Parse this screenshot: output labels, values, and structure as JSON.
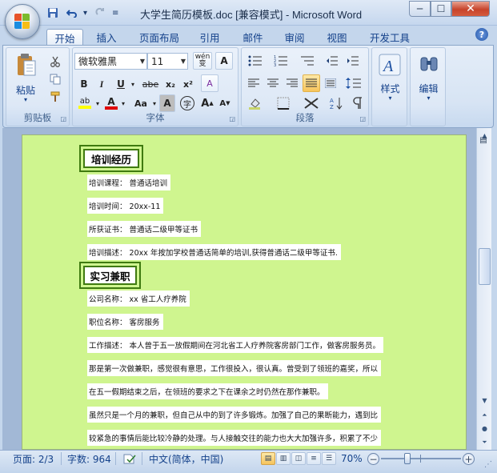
{
  "window": {
    "title": "大学生简历模板.doc [兼容模式] - Microsoft Word",
    "minimize": "─",
    "maximize": "☐",
    "close": "✕"
  },
  "quick_access": {
    "save_icon": "save-icon",
    "undo_icon": "undo-icon",
    "redo_icon": "redo-icon",
    "customize_icon": "customize-qat-icon"
  },
  "tabs": [
    {
      "label": "开始",
      "active": true
    },
    {
      "label": "插入",
      "active": false
    },
    {
      "label": "页面布局",
      "active": false
    },
    {
      "label": "引用",
      "active": false
    },
    {
      "label": "邮件",
      "active": false
    },
    {
      "label": "审阅",
      "active": false
    },
    {
      "label": "视图",
      "active": false
    },
    {
      "label": "开发工具",
      "active": false
    }
  ],
  "ribbon": {
    "clipboard": {
      "group_label": "剪贴板",
      "paste_label": "粘贴"
    },
    "font": {
      "group_label": "字体",
      "font_name": "微软雅黑",
      "font_size": "11",
      "wen_label": "wén",
      "wen_char": "变",
      "a_box": "A",
      "bold": "B",
      "italic": "I",
      "underline": "U",
      "strike": "abe",
      "subscript": "x₂",
      "superscript": "x²",
      "clear_format": "A",
      "highlight": "ab",
      "font_color": "A",
      "change_case": "Aa",
      "char_shade": "A",
      "enclose": "字",
      "grow": "A",
      "shrink": "A"
    },
    "paragraph": {
      "group_label": "段落"
    },
    "styles": {
      "label": "样式",
      "icon": "styles-icon"
    },
    "editing": {
      "label": "编辑",
      "icon": "find-binoculars-icon"
    }
  },
  "document": {
    "sections": [
      {
        "heading": "培训经历"
      },
      {
        "heading": "实习兼职"
      }
    ],
    "lines": [
      "培训课程：   普通话培训",
      "培训时间：   20xx-11",
      "所获证书：   普通话二级甲等证书",
      "培训描述：   20xx 年按加学校普通话简单的培训,获得普通话二级甲等证书.",
      "公司名称：   xx 省工人疗养院",
      "职位名称：   客房服务",
      "工作描述：  本人曾于五一放假期间在河北省工人疗养院客房部门工作，做客房服务员。",
      "那是第一次做兼职，感觉很有意思，工作很投入，很认真。曾受到了领班的嘉奖，所以",
      "在五一假期结束之后，在领班的要求之下在课余之时仍然在那作兼职。",
      "虽然只是一个月的兼职，但自己从中的到了许多锻炼。加强了自己的果断能力，遇到比",
      "较紧急的事情后能比较冷静的处理。与人接触交往的能力也大大加强许多，积累了不少"
    ]
  },
  "statusbar": {
    "page": "页面: 2/3",
    "words": "字数: 964",
    "language": "中文(简体，中国)",
    "zoom": "70%",
    "zoom_out": "−",
    "zoom_in": "+"
  },
  "colors": {
    "page_bg": "#cff58f",
    "heading_border": "#3f7a10",
    "ribbon_text": "#15428b"
  }
}
